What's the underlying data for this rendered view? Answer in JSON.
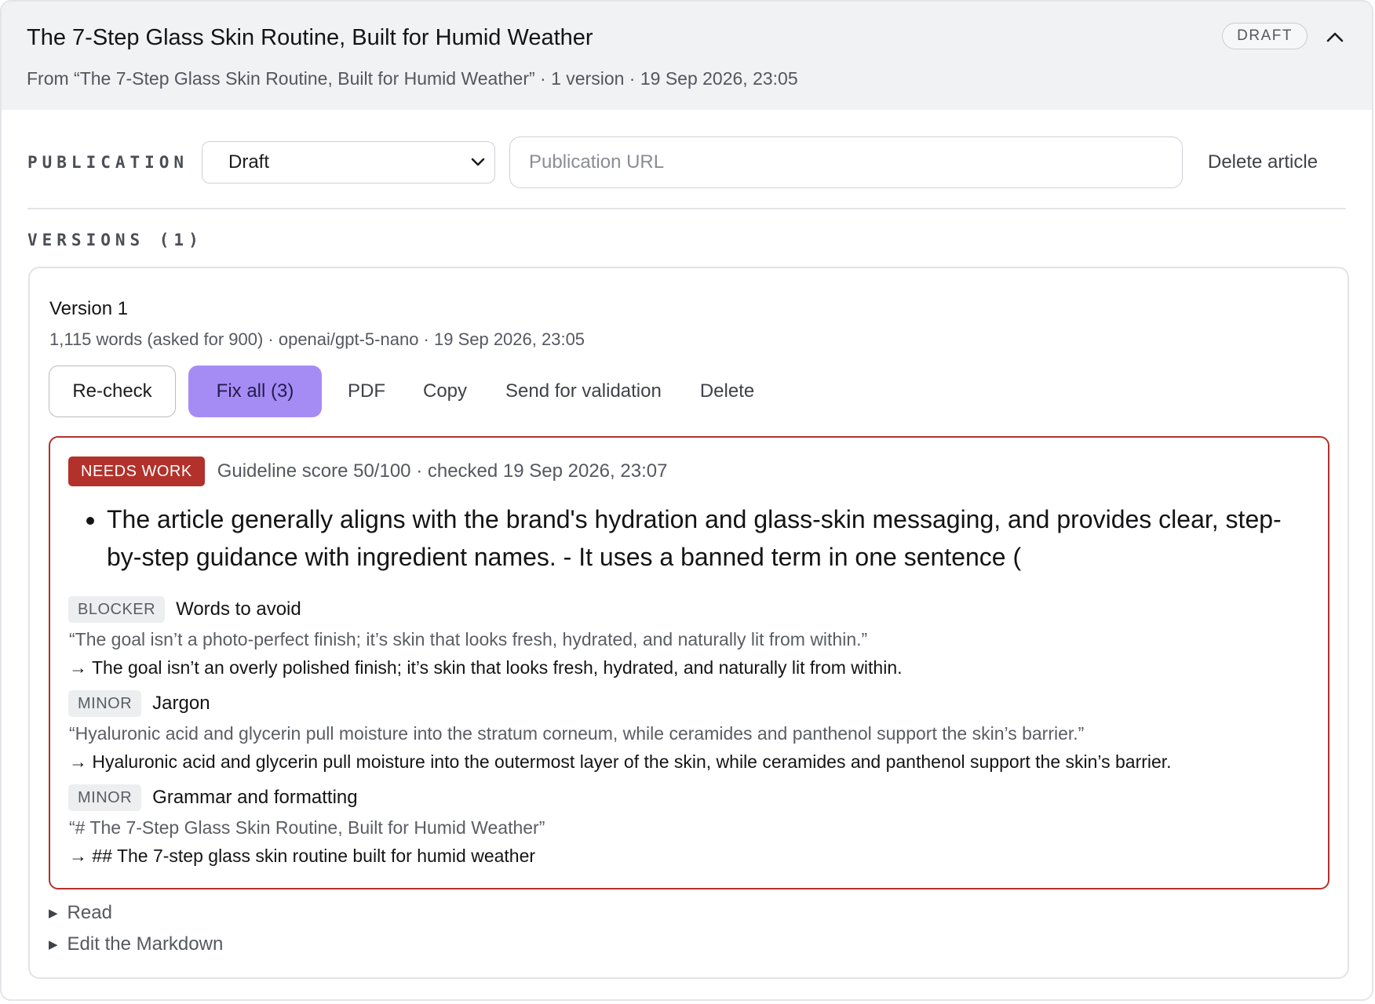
{
  "header": {
    "title": "The 7-Step Glass Skin Routine, Built for Humid Weather",
    "subtitle": "From “The 7-Step Glass Skin Routine, Built for Humid Weather” · 1 version · 19 Sep 2026, 23:05",
    "status_pill": "DRAFT",
    "collapse_icon": "chevron-up-icon"
  },
  "publication": {
    "label": "PUBLICATION",
    "status_selected": "Draft",
    "url_placeholder": "Publication URL",
    "url_value": "",
    "delete_label": "Delete article"
  },
  "versions": {
    "label": "VERSIONS (1)",
    "items": [
      {
        "title": "Version 1",
        "meta": "1,115 words (asked for 900) · openai/gpt-5-nano · 19 Sep 2026, 23:05",
        "actions": {
          "recheck": "Re-check",
          "fix_all": "Fix all (3)",
          "pdf": "PDF",
          "copy": "Copy",
          "send": "Send for validation",
          "delete": "Delete"
        },
        "report": {
          "badge": "NEEDS WORK",
          "score_line": "Guideline score 50/100 · checked 19 Sep 2026, 23:07",
          "summary": "The article generally aligns with the brand's hydration and glass-skin messaging, and provides clear, step-by-step guidance with ingredient names. - It uses a banned term in one sentence (",
          "colors": {
            "badge": "#b3312b",
            "border": "#b3312b"
          },
          "issues": [
            {
              "severity": "BLOCKER",
              "category": "Words to avoid",
              "quote": "“The goal isn’t a photo-perfect finish; it’s skin that looks fresh, hydrated, and naturally lit from within.”",
              "fix": "→ The goal isn’t an overly polished finish; it’s skin that looks fresh, hydrated, and naturally lit from within."
            },
            {
              "severity": "MINOR",
              "category": "Jargon",
              "quote": "“Hyaluronic acid and glycerin pull moisture into the stratum corneum, while ceramides and panthenol support the skin’s barrier.”",
              "fix": "→ Hyaluronic acid and glycerin pull moisture into the outermost layer of the skin, while ceramides and panthenol support the skin’s barrier."
            },
            {
              "severity": "MINOR",
              "category": "Grammar and formatting",
              "quote": "“# The 7-Step Glass Skin Routine, Built for Humid Weather”",
              "fix": "→ ## The 7-step glass skin routine built for humid weather"
            }
          ]
        },
        "toggles": {
          "read": "Read",
          "edit": "Edit the Markdown"
        }
      }
    ]
  },
  "colors": {
    "accent": "#a58cf5",
    "danger": "#b3312b",
    "header_bg": "#f1f2f4"
  }
}
